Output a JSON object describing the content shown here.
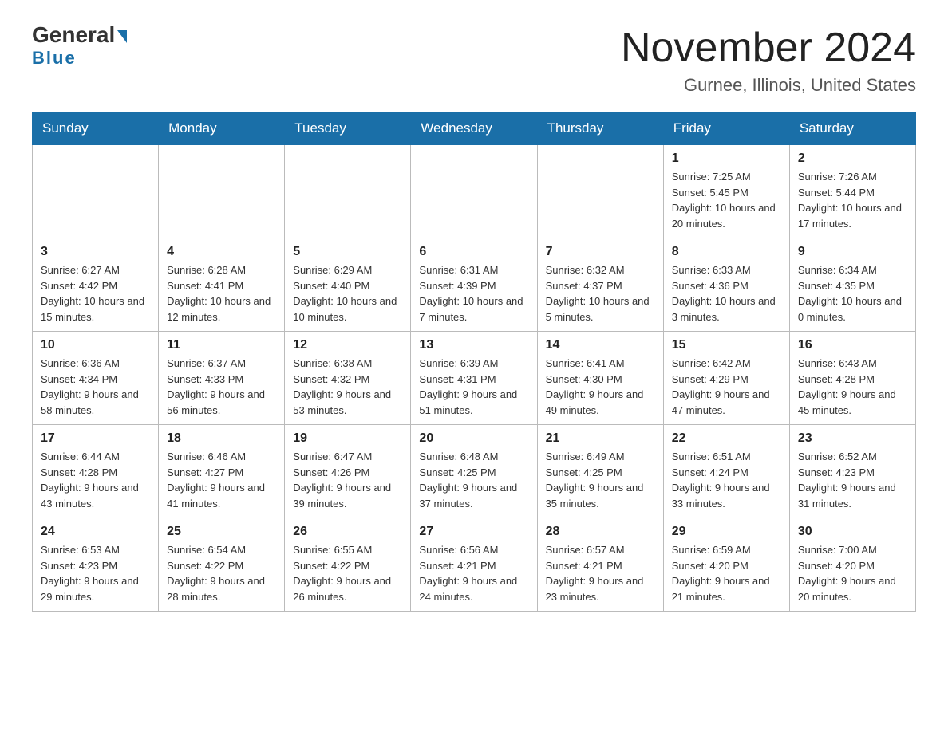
{
  "header": {
    "logo_general": "General",
    "logo_blue": "Blue",
    "title": "November 2024",
    "subtitle": "Gurnee, Illinois, United States"
  },
  "weekdays": [
    "Sunday",
    "Monday",
    "Tuesday",
    "Wednesday",
    "Thursday",
    "Friday",
    "Saturday"
  ],
  "weeks": [
    [
      {
        "day": "",
        "info": ""
      },
      {
        "day": "",
        "info": ""
      },
      {
        "day": "",
        "info": ""
      },
      {
        "day": "",
        "info": ""
      },
      {
        "day": "",
        "info": ""
      },
      {
        "day": "1",
        "info": "Sunrise: 7:25 AM\nSunset: 5:45 PM\nDaylight: 10 hours and 20 minutes."
      },
      {
        "day": "2",
        "info": "Sunrise: 7:26 AM\nSunset: 5:44 PM\nDaylight: 10 hours and 17 minutes."
      }
    ],
    [
      {
        "day": "3",
        "info": "Sunrise: 6:27 AM\nSunset: 4:42 PM\nDaylight: 10 hours and 15 minutes."
      },
      {
        "day": "4",
        "info": "Sunrise: 6:28 AM\nSunset: 4:41 PM\nDaylight: 10 hours and 12 minutes."
      },
      {
        "day": "5",
        "info": "Sunrise: 6:29 AM\nSunset: 4:40 PM\nDaylight: 10 hours and 10 minutes."
      },
      {
        "day": "6",
        "info": "Sunrise: 6:31 AM\nSunset: 4:39 PM\nDaylight: 10 hours and 7 minutes."
      },
      {
        "day": "7",
        "info": "Sunrise: 6:32 AM\nSunset: 4:37 PM\nDaylight: 10 hours and 5 minutes."
      },
      {
        "day": "8",
        "info": "Sunrise: 6:33 AM\nSunset: 4:36 PM\nDaylight: 10 hours and 3 minutes."
      },
      {
        "day": "9",
        "info": "Sunrise: 6:34 AM\nSunset: 4:35 PM\nDaylight: 10 hours and 0 minutes."
      }
    ],
    [
      {
        "day": "10",
        "info": "Sunrise: 6:36 AM\nSunset: 4:34 PM\nDaylight: 9 hours and 58 minutes."
      },
      {
        "day": "11",
        "info": "Sunrise: 6:37 AM\nSunset: 4:33 PM\nDaylight: 9 hours and 56 minutes."
      },
      {
        "day": "12",
        "info": "Sunrise: 6:38 AM\nSunset: 4:32 PM\nDaylight: 9 hours and 53 minutes."
      },
      {
        "day": "13",
        "info": "Sunrise: 6:39 AM\nSunset: 4:31 PM\nDaylight: 9 hours and 51 minutes."
      },
      {
        "day": "14",
        "info": "Sunrise: 6:41 AM\nSunset: 4:30 PM\nDaylight: 9 hours and 49 minutes."
      },
      {
        "day": "15",
        "info": "Sunrise: 6:42 AM\nSunset: 4:29 PM\nDaylight: 9 hours and 47 minutes."
      },
      {
        "day": "16",
        "info": "Sunrise: 6:43 AM\nSunset: 4:28 PM\nDaylight: 9 hours and 45 minutes."
      }
    ],
    [
      {
        "day": "17",
        "info": "Sunrise: 6:44 AM\nSunset: 4:28 PM\nDaylight: 9 hours and 43 minutes."
      },
      {
        "day": "18",
        "info": "Sunrise: 6:46 AM\nSunset: 4:27 PM\nDaylight: 9 hours and 41 minutes."
      },
      {
        "day": "19",
        "info": "Sunrise: 6:47 AM\nSunset: 4:26 PM\nDaylight: 9 hours and 39 minutes."
      },
      {
        "day": "20",
        "info": "Sunrise: 6:48 AM\nSunset: 4:25 PM\nDaylight: 9 hours and 37 minutes."
      },
      {
        "day": "21",
        "info": "Sunrise: 6:49 AM\nSunset: 4:25 PM\nDaylight: 9 hours and 35 minutes."
      },
      {
        "day": "22",
        "info": "Sunrise: 6:51 AM\nSunset: 4:24 PM\nDaylight: 9 hours and 33 minutes."
      },
      {
        "day": "23",
        "info": "Sunrise: 6:52 AM\nSunset: 4:23 PM\nDaylight: 9 hours and 31 minutes."
      }
    ],
    [
      {
        "day": "24",
        "info": "Sunrise: 6:53 AM\nSunset: 4:23 PM\nDaylight: 9 hours and 29 minutes."
      },
      {
        "day": "25",
        "info": "Sunrise: 6:54 AM\nSunset: 4:22 PM\nDaylight: 9 hours and 28 minutes."
      },
      {
        "day": "26",
        "info": "Sunrise: 6:55 AM\nSunset: 4:22 PM\nDaylight: 9 hours and 26 minutes."
      },
      {
        "day": "27",
        "info": "Sunrise: 6:56 AM\nSunset: 4:21 PM\nDaylight: 9 hours and 24 minutes."
      },
      {
        "day": "28",
        "info": "Sunrise: 6:57 AM\nSunset: 4:21 PM\nDaylight: 9 hours and 23 minutes."
      },
      {
        "day": "29",
        "info": "Sunrise: 6:59 AM\nSunset: 4:20 PM\nDaylight: 9 hours and 21 minutes."
      },
      {
        "day": "30",
        "info": "Sunrise: 7:00 AM\nSunset: 4:20 PM\nDaylight: 9 hours and 20 minutes."
      }
    ]
  ]
}
